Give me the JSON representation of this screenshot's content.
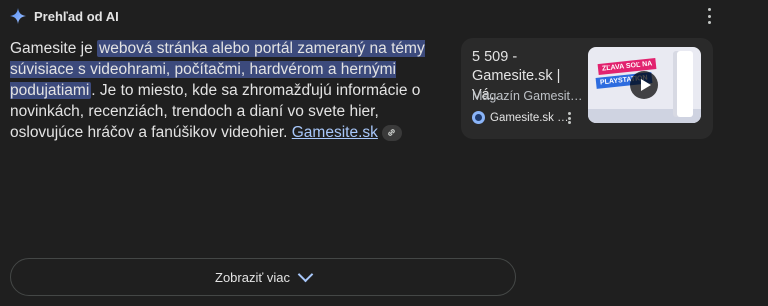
{
  "header": {
    "title": "Prehľad od AI",
    "icon": "gemini-sparkle-icon"
  },
  "answer": {
    "prefix": "Gamesite je ",
    "highlight": "webová stránka alebo portál zameraný na témy súvisiace s videohrami, počítačmi, hardvérom a hernými podujatiami",
    "rest": ". Je to miesto, kde sa zhromažďujú informácie o novinkách, recenziách, trendoch a dianí vo svete hier, oslovujúce hráčov a fanúšikov videohier. ",
    "source_link": "Gamesite.sk",
    "link_icon": "link-icon"
  },
  "source_card": {
    "title": "5 509 - Gamesite.sk | Vá…",
    "subtitle": "Magazín Gamesit…",
    "site": "Gamesite.sk …",
    "thumbnail": {
      "banner_top": "ZĽAVA SOĽ NA",
      "banner_bottom": "PLAYSTATION"
    },
    "play_icon": "play-icon"
  },
  "show_more": {
    "label": "Zobraziť viac",
    "icon": "chevron-down-icon"
  },
  "colors": {
    "background": "#1f1f1f",
    "highlight": "#3c4a7c",
    "link": "#a8c7fa",
    "card": "#2a2a2a"
  }
}
